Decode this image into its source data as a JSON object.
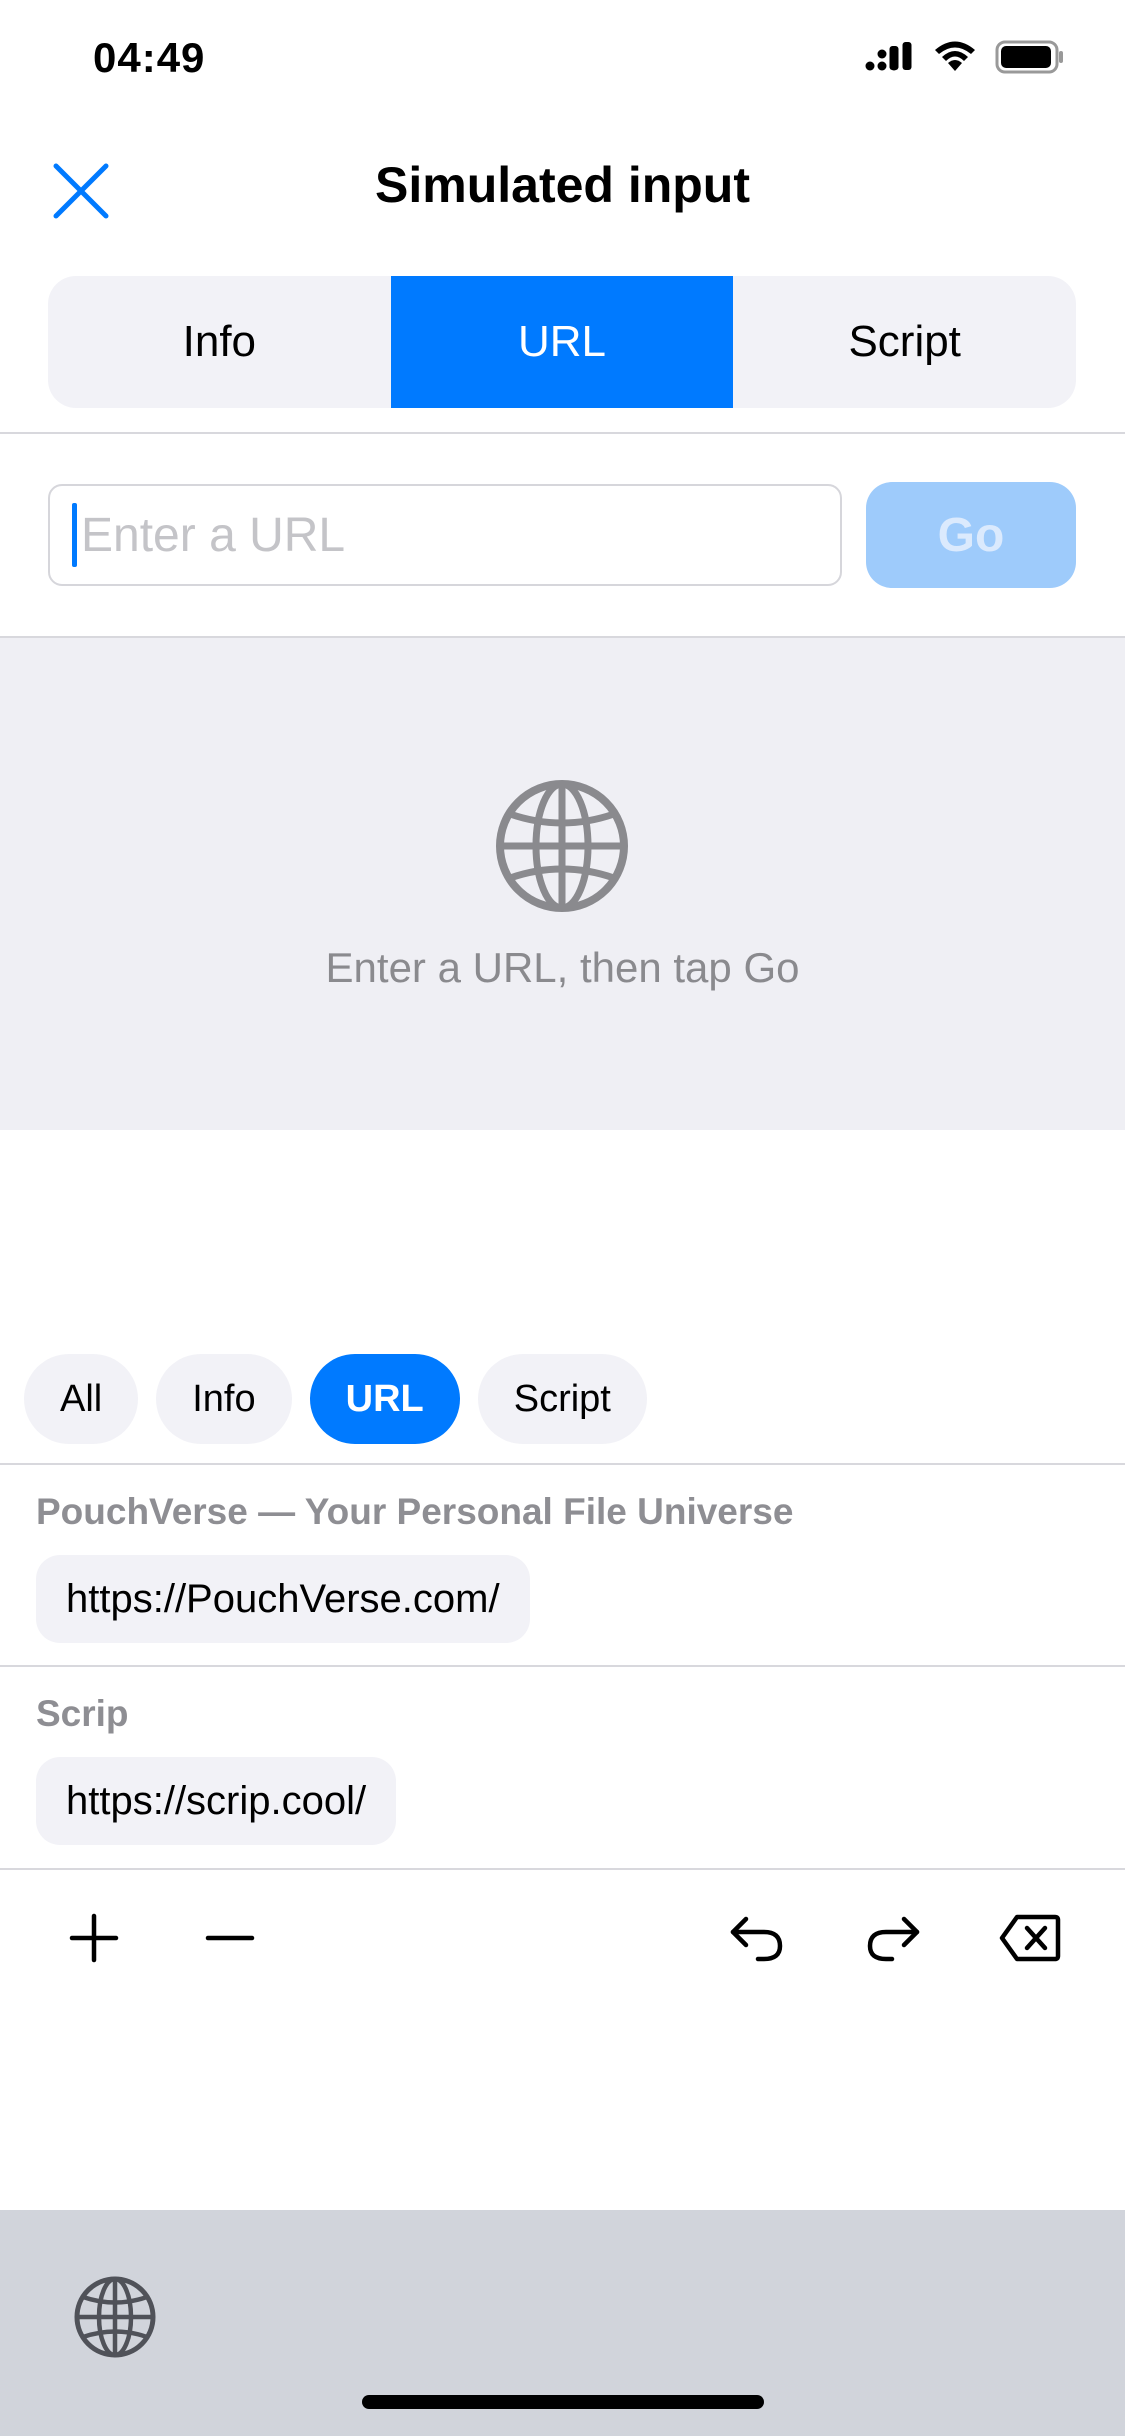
{
  "status_bar": {
    "time": "04:49",
    "icons": [
      "cellular-signal-icon",
      "wifi-icon",
      "battery-icon"
    ]
  },
  "nav": {
    "title": "Simulated input",
    "close_icon": "close-icon"
  },
  "segmented": {
    "tabs": [
      {
        "label": "Info",
        "active": false
      },
      {
        "label": "URL",
        "active": true
      },
      {
        "label": "Script",
        "active": false
      }
    ]
  },
  "url_entry": {
    "value": "",
    "placeholder": "Enter a URL",
    "go_label": "Go",
    "go_enabled": false
  },
  "empty_state": {
    "icon": "globe-icon",
    "message": "Enter a URL, then tap Go"
  },
  "filter_chips": [
    {
      "label": "All",
      "active": false
    },
    {
      "label": "Info",
      "active": false
    },
    {
      "label": "URL",
      "active": true
    },
    {
      "label": "Script",
      "active": false
    }
  ],
  "history": [
    {
      "title": "PouchVerse — Your Personal File Universe",
      "url": "https://PouchVerse.com/"
    },
    {
      "title": "Scrip",
      "url": "https://scrip.cool/"
    }
  ],
  "toolbar": {
    "left": [
      "plus-icon",
      "minus-icon"
    ],
    "right": [
      "undo-icon",
      "redo-icon",
      "delete-backward-icon"
    ]
  },
  "keyboard": {
    "icon": "globe-icon"
  },
  "colors": {
    "accent": "#007aff",
    "accent_disabled": "#9ecbfb",
    "chip_bg": "#f2f2f7",
    "empty_bg": "#efeff4",
    "secondary_text": "#8e8e93",
    "keyboard_bg": "#d1d4db"
  }
}
